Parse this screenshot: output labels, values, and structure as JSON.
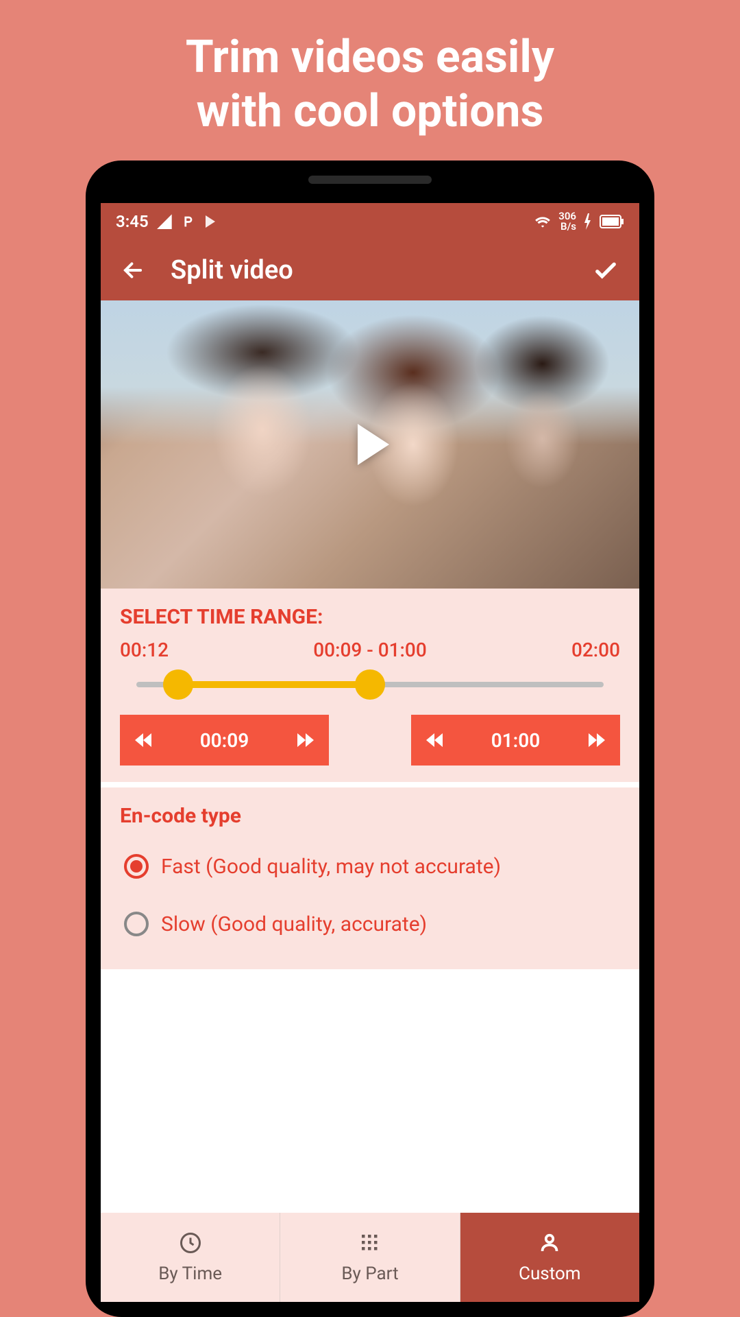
{
  "promo": {
    "line1": "Trim videos easily",
    "line2": "with cool options"
  },
  "status": {
    "time": "3:45",
    "net_speed_top": "306",
    "net_speed_bottom": "B/s"
  },
  "appbar": {
    "title": "Split video"
  },
  "time_range": {
    "title": "SELECT TIME RANGE:",
    "start_label": "00:12",
    "mid_label": "00:09 - 01:00",
    "end_label": "02:00",
    "control_start": "00:09",
    "control_end": "01:00",
    "handle1_pct": 9,
    "handle2_pct": 50
  },
  "encode": {
    "title": "En-code type",
    "options": [
      {
        "label": "Fast (Good quality, may not accurate)",
        "selected": true
      },
      {
        "label": "Slow (Good quality, accurate)",
        "selected": false
      }
    ]
  },
  "tabs": [
    {
      "label": "By Time",
      "icon": "clock",
      "active": false
    },
    {
      "label": "By Part",
      "icon": "grid",
      "active": false
    },
    {
      "label": "Custom",
      "icon": "person",
      "active": true
    }
  ]
}
